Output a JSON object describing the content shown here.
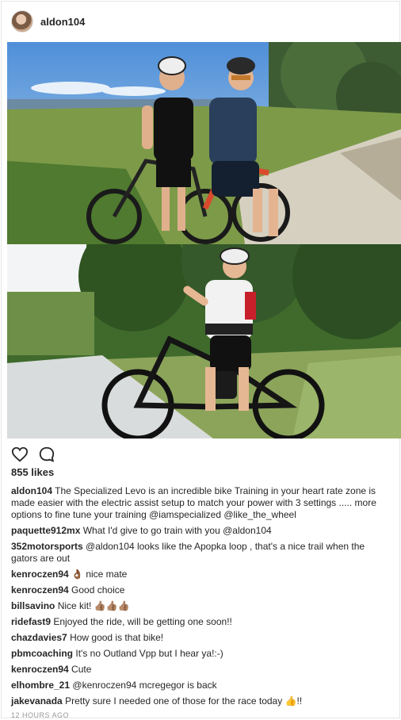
{
  "post": {
    "username": "aldon104",
    "likes": "855 likes",
    "timestamp": "12 HOURS AGO"
  },
  "comments": [
    {
      "user": "aldon104",
      "text": "The Specialized Levo is an incredible bike Training in your heart rate zone is made easier with the electric assist setup to match your power with 3 settings ..... more options to fine tune your training @iamspecialized @like_the_wheel"
    },
    {
      "user": "paquette912mx",
      "text": "What I'd give to go train with you @aldon104"
    },
    {
      "user": "352motorsports",
      "text": "@aldon104 looks like the Apopka loop , that's a nice trail when the gators are out"
    },
    {
      "user": "kenroczen94",
      "text": "👌🏾 nice mate"
    },
    {
      "user": "kenroczen94",
      "text": "Good choice"
    },
    {
      "user": "billsavino",
      "text": "Nice kit! 👍🏽👍🏽👍🏽"
    },
    {
      "user": "ridefast9",
      "text": "Enjoyed the ride, will be getting one soon!!"
    },
    {
      "user": "chazdavies7",
      "text": "How good is that bike!"
    },
    {
      "user": "pbmcoaching",
      "text": "It's no Outland Vpp but I hear ya!:-)"
    },
    {
      "user": "kenroczen94",
      "text": "Cute"
    },
    {
      "user": "elhombre_21",
      "text": "@kenroczen94 mcregegor is back"
    },
    {
      "user": "jakevanada",
      "text": "Pretty sure I needed one of those for the race today 👍!!"
    }
  ],
  "icons": {
    "like": "heart-icon",
    "comment": "comment-bubble-icon"
  }
}
